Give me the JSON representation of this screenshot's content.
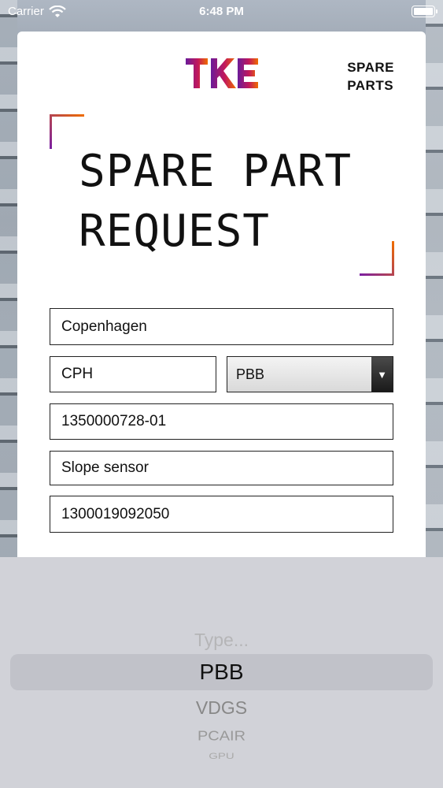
{
  "status_bar": {
    "carrier": "Carrier",
    "time": "6:48 PM"
  },
  "header": {
    "section_line1": "SPARE",
    "section_line2": "PARTS"
  },
  "brand": {
    "logo": "TKE"
  },
  "title": {
    "line1": "SPARE PART",
    "line2": "REQUEST"
  },
  "form": {
    "city": "Copenhagen",
    "airport_code": "CPH",
    "type_selected": "PBB",
    "serial_number": "1350000728-01",
    "part_name": "Slope sensor",
    "part_number": "1300019092050"
  },
  "picker": {
    "options": [
      "Type...",
      "PBB",
      "VDGS",
      "PCAIR",
      "GPU"
    ],
    "selected": "PBB"
  },
  "colors": {
    "accent_purple": "#7b1fa2",
    "accent_orange": "#ef6c00"
  }
}
